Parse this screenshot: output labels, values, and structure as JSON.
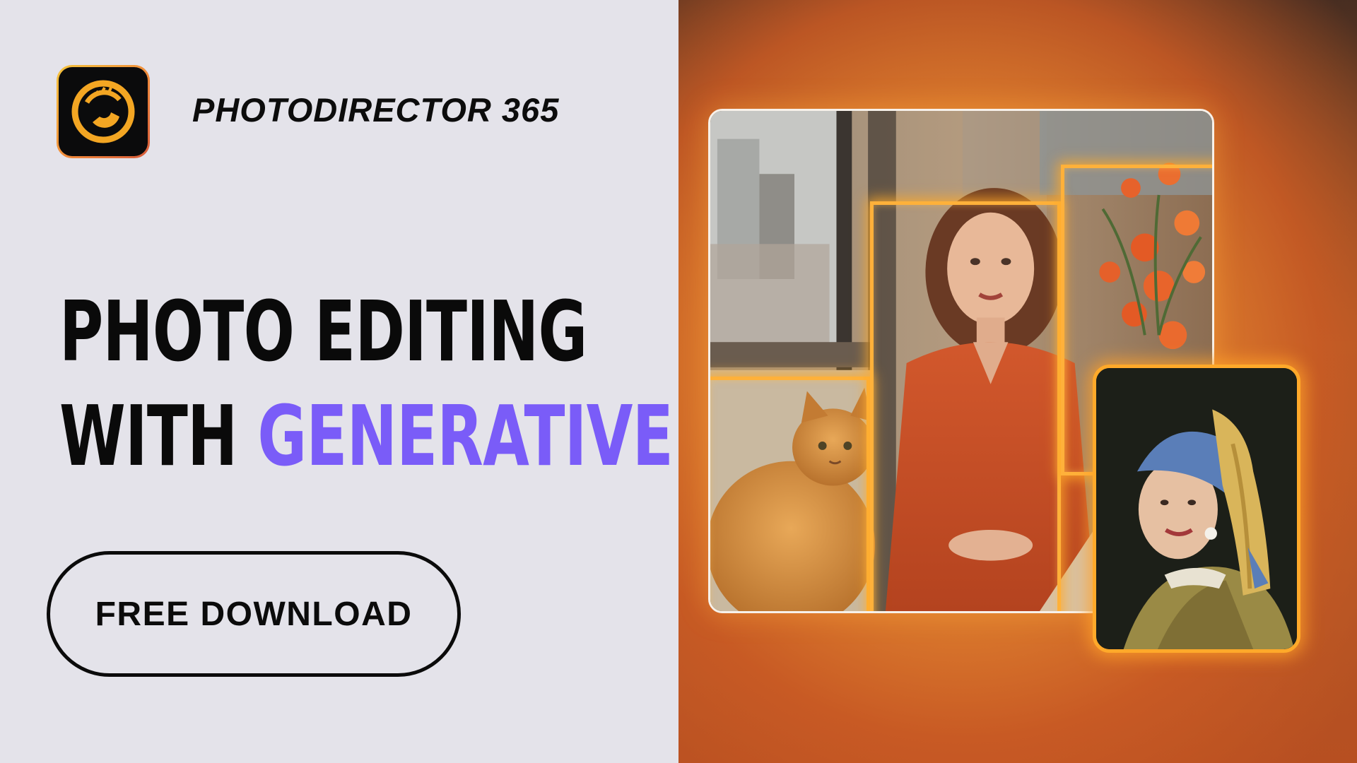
{
  "brand": {
    "name": "PHOTODIRECTOR 365",
    "icon": "photodirector-logo-icon"
  },
  "headline": {
    "line1": "PHOTO EDITING",
    "line2_prefix": "WITH ",
    "line2_accent": "GENERATIVE AI"
  },
  "cta": {
    "label": "FREE DOWNLOAD"
  },
  "colors": {
    "background_left": "#e4e3ea",
    "accent_purple": "#7a5cf8",
    "glow_orange": "#ffb13a",
    "text_dark": "#0a0a0a"
  }
}
